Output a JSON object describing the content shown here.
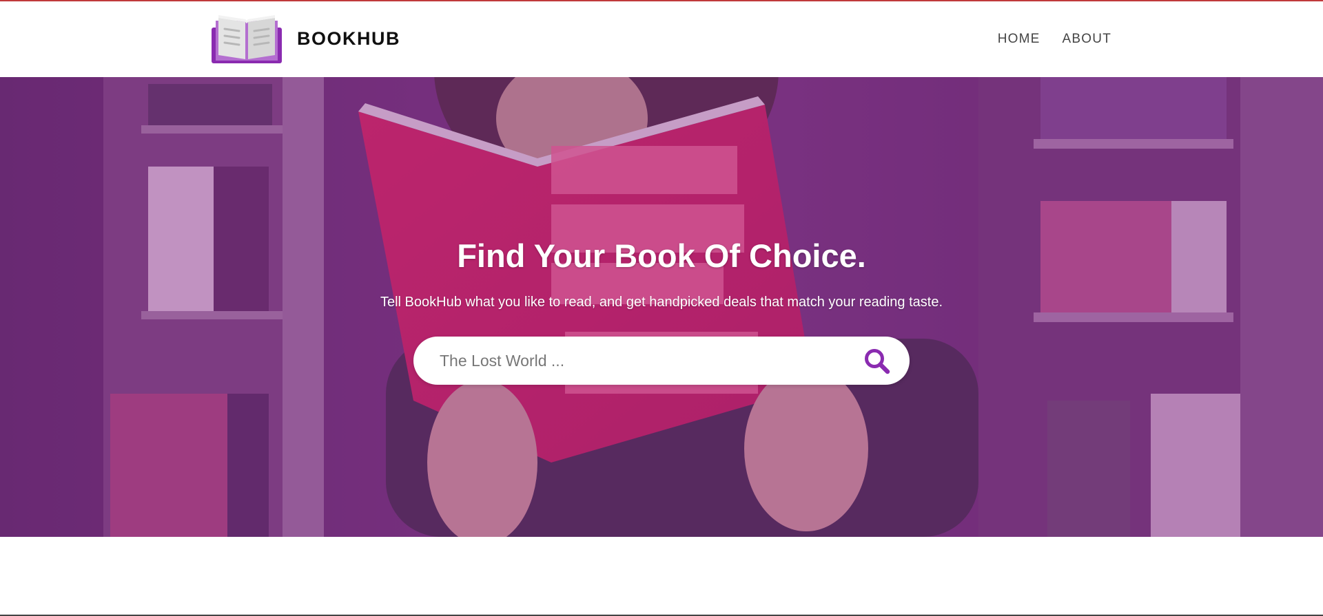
{
  "brand": {
    "name": "BOOKHUB",
    "logo_icon": "open-book-icon"
  },
  "nav": {
    "items": [
      {
        "label": "HOME"
      },
      {
        "label": "ABOUT"
      }
    ]
  },
  "hero": {
    "title": "Find Your Book Of Choice.",
    "subtitle": "Tell BookHub what you like to read, and get handpicked deals that match your reading taste.",
    "background": "photo of a person reading a red book in front of bookshelves",
    "overlay_color": "#80288c"
  },
  "search": {
    "placeholder": "The Lost World ...",
    "value": "",
    "icon": "search-icon",
    "icon_color": "#8a2bb0"
  },
  "colors": {
    "accent": "#8a2bb0",
    "top_border": "#c0393b"
  }
}
